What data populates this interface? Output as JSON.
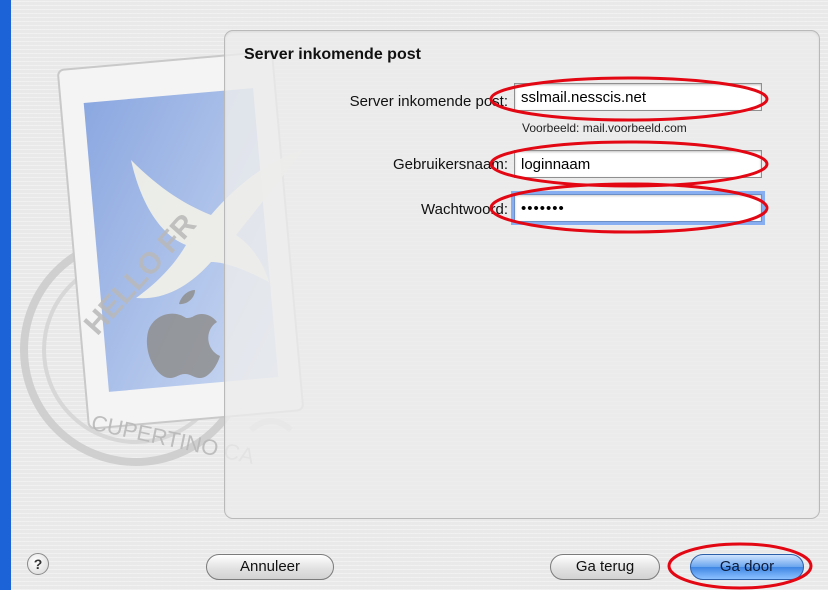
{
  "panel": {
    "title": "Server inkomende post"
  },
  "fields": {
    "server": {
      "label": "Server inkomende post:",
      "value": "sslmail.nesscis.net",
      "hint": "Voorbeeld: mail.voorbeeld.com"
    },
    "username": {
      "label": "Gebruikersnaam:",
      "value": "loginnaam"
    },
    "password": {
      "label": "Wachtwoord:",
      "value": "•••••••"
    }
  },
  "buttons": {
    "help": "?",
    "cancel": "Annuleer",
    "back": "Ga terug",
    "continue": "Ga door"
  },
  "artwork": {
    "stamp_text_top": "HELLO FR",
    "stamp_text_bottom": "CUPERTINO CA"
  },
  "colors": {
    "desktop": "#1b63d6",
    "annotation": "#e30613",
    "focus_ring": "#86aef0"
  },
  "icons": [
    "mail-stamp-icon",
    "help-icon"
  ]
}
